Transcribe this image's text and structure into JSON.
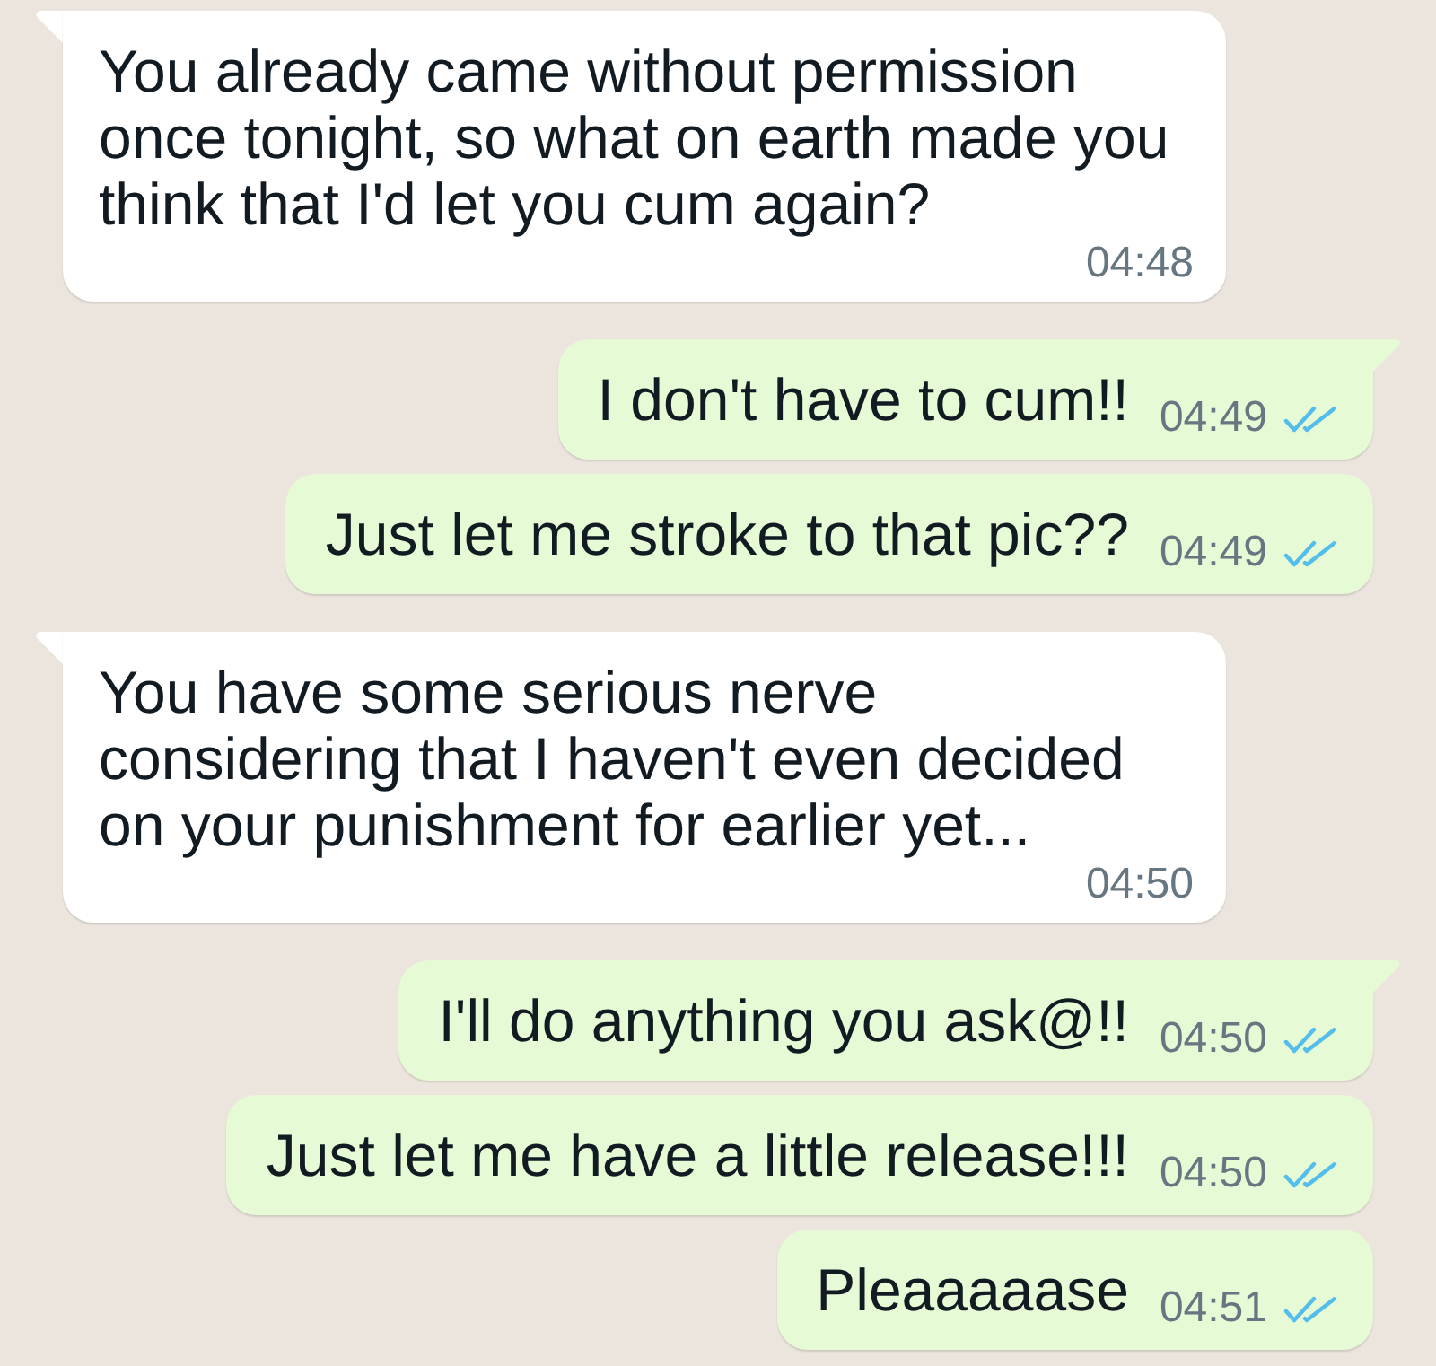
{
  "messages": [
    {
      "kind": "incoming",
      "tail": true,
      "text": "You already came without permission\nonce tonight, so what on earth made you\nthink that I'd let you cum again?",
      "time": "04:48"
    },
    {
      "kind": "outgoing",
      "tail": true,
      "text": "I don't have to cum!!",
      "time": "04:49",
      "read": true
    },
    {
      "kind": "outgoing",
      "tail": false,
      "text": "Just let me stroke to that pic??",
      "time": "04:49",
      "read": true
    },
    {
      "kind": "incoming",
      "tail": true,
      "text": "You have some serious nerve\nconsidering that I haven't even decided\non your punishment for earlier yet...",
      "time": "04:50"
    },
    {
      "kind": "outgoing",
      "tail": true,
      "text": "I'll do anything you ask@!!",
      "time": "04:50",
      "read": true
    },
    {
      "kind": "outgoing",
      "tail": false,
      "text": "Just let me have a little release!!!",
      "time": "04:50",
      "read": true
    },
    {
      "kind": "outgoing",
      "tail": false,
      "text": "Pleaaaaase",
      "time": "04:51",
      "read": true
    }
  ]
}
